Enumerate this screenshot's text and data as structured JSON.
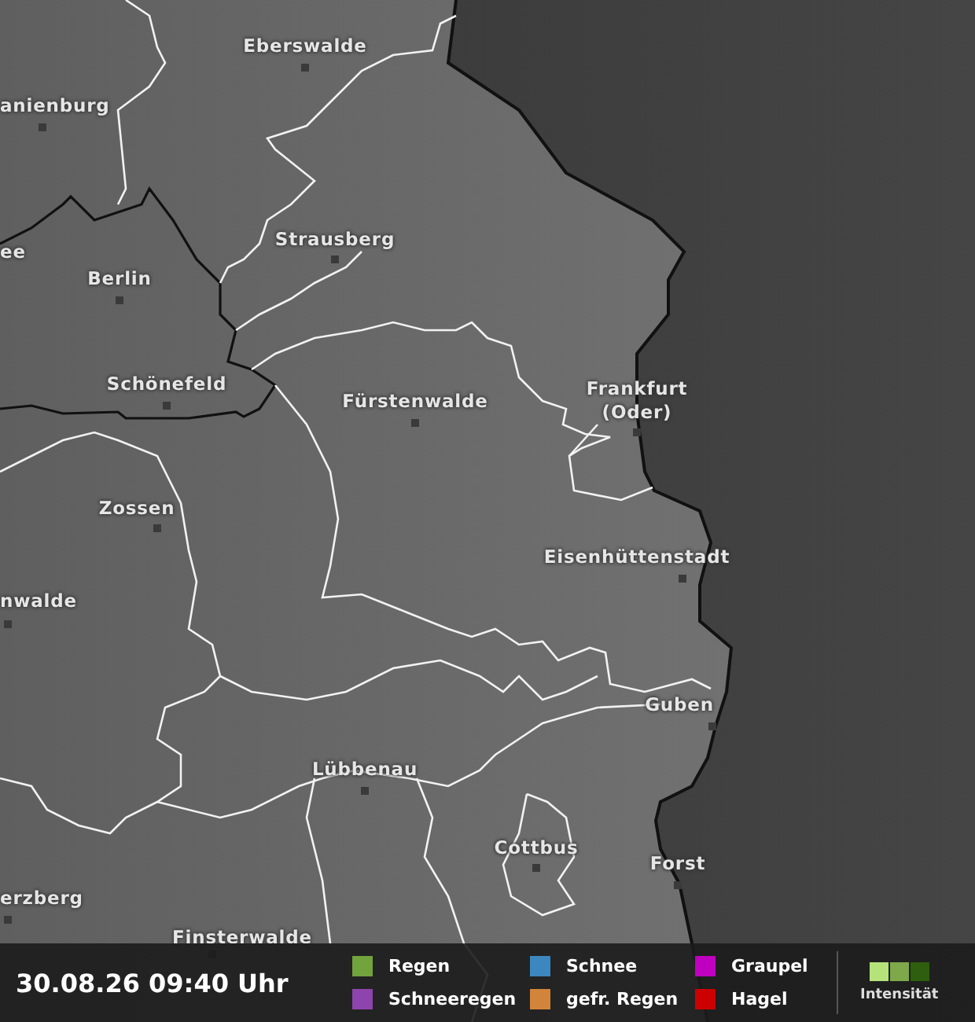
{
  "map": {
    "cities": [
      {
        "name": "anienburg"
      },
      {
        "name": "Eberswalde"
      },
      {
        "name": "ee"
      },
      {
        "name": "Berlin"
      },
      {
        "name": "Strausberg"
      },
      {
        "name": "Schönefeld"
      },
      {
        "name": "Fürstenwalde"
      },
      {
        "name": "Frankfurt (Oder)"
      },
      {
        "name": "Zossen"
      },
      {
        "name": "nwalde"
      },
      {
        "name": "Eisenhüttenstadt"
      },
      {
        "name": "Guben"
      },
      {
        "name": "Lübbenau"
      },
      {
        "name": "Cottbus"
      },
      {
        "name": "Forst"
      },
      {
        "name": "erzberg"
      },
      {
        "name": "Finsterwalde"
      }
    ]
  },
  "status_bar": {
    "timestamp": "30.08.26 09:40 Uhr",
    "legend": [
      {
        "label": "Regen",
        "color": "#72a33c"
      },
      {
        "label": "Schneeregen",
        "color": "#8e44ad"
      },
      {
        "label": "Schnee",
        "color": "#3d87c0"
      },
      {
        "label": "gefr. Regen",
        "color": "#d2843a"
      },
      {
        "label": "Graupel",
        "color": "#c000c0"
      },
      {
        "label": "Hagel",
        "color": "#cc0000"
      }
    ],
    "intensity": {
      "label": "Intensität",
      "levels": [
        {
          "color": "#b5e37a"
        },
        {
          "color": "#7fa84a"
        },
        {
          "color": "#2f5e0f"
        }
      ]
    }
  }
}
